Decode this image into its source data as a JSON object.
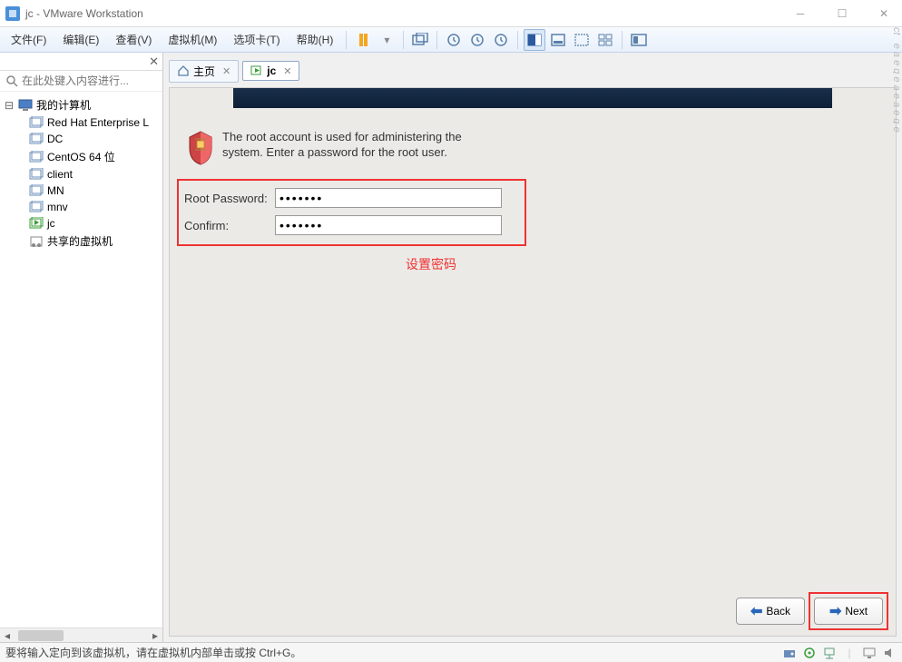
{
  "window": {
    "title": "jc - VMware Workstation"
  },
  "menu": {
    "file": "文件(F)",
    "edit": "编辑(E)",
    "view": "查看(V)",
    "vm": "虚拟机(M)",
    "tabs": "选项卡(T)",
    "help": "帮助(H)"
  },
  "sidebar": {
    "search_placeholder": "在此处键入内容进行...",
    "root": "我的计算机",
    "items": [
      "Red Hat Enterprise L",
      "DC",
      "CentOS 64 位",
      "client",
      "MN",
      "mnv",
      "jc"
    ],
    "shared": "共享的虚拟机"
  },
  "tabs": {
    "home": "主页",
    "current": "jc"
  },
  "installer": {
    "description": "The root account is used for administering the system.  Enter a password for the root user.",
    "root_password_label": "Root Password:",
    "confirm_label": "Confirm:",
    "root_password_value": "•••••••",
    "confirm_value": "•••••••",
    "annotation": "设置密码",
    "back": "Back",
    "next": "Next"
  },
  "statusbar": {
    "text": "要将输入定向到该虚拟机，请在虚拟机内部单击或按 Ctrl+G。"
  }
}
